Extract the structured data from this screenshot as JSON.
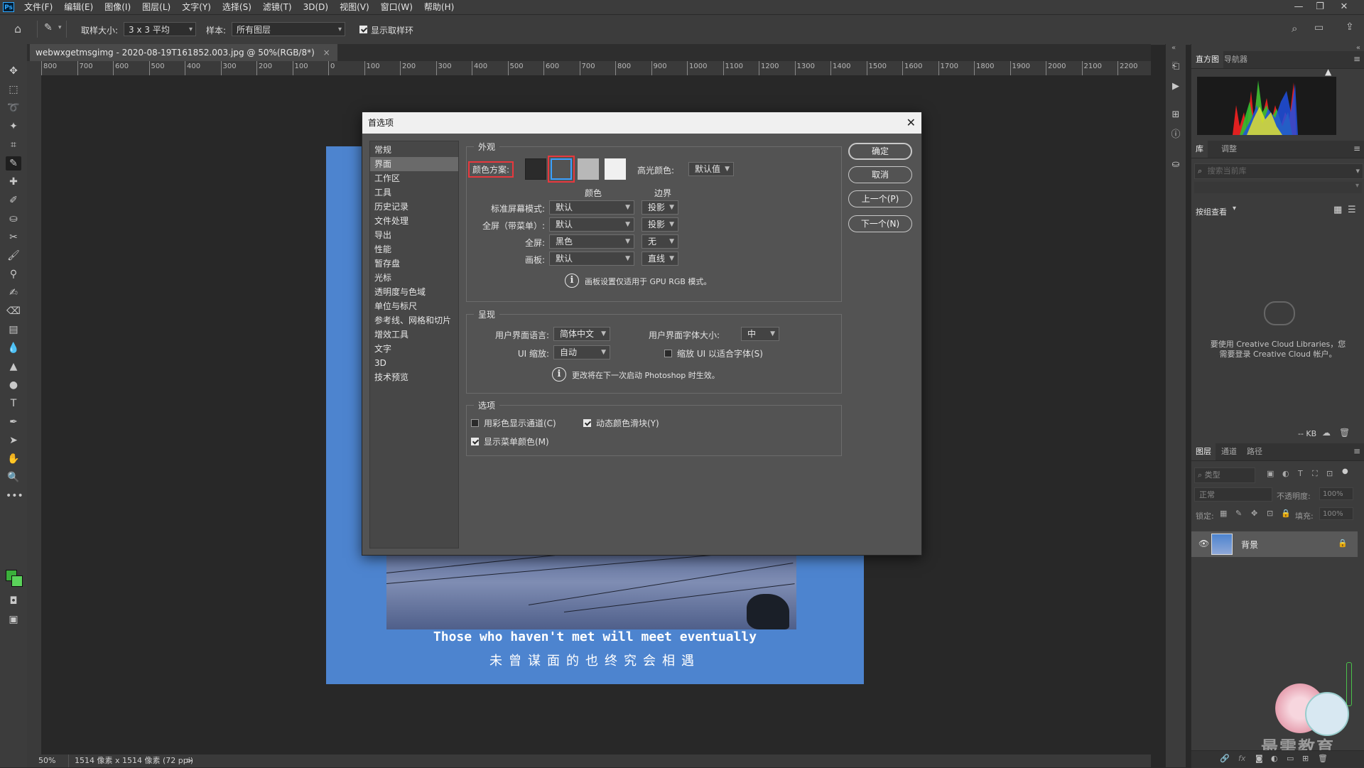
{
  "app": {
    "logo": "Ps",
    "menu": [
      "文件(F)",
      "编辑(E)",
      "图像(I)",
      "图层(L)",
      "文字(Y)",
      "选择(S)",
      "滤镜(T)",
      "3D(D)",
      "视图(V)",
      "窗口(W)",
      "帮助(H)"
    ]
  },
  "options_bar": {
    "sample_size_label": "取样大小:",
    "sample_size_value": "3 x 3 平均",
    "sample_label": "样本:",
    "sample_value": "所有图层",
    "show_ring_label": "显示取样环",
    "show_ring_checked": true
  },
  "document": {
    "tab_title": "webwxgetmsgimg - 2020-08-19T161852.003.jpg @ 50%(RGB/8*)",
    "tab_close": "×",
    "ruler_ticks": [
      "800",
      "700",
      "600",
      "500",
      "400",
      "300",
      "200",
      "100",
      "0",
      "100",
      "200",
      "300",
      "400",
      "500",
      "600",
      "700",
      "800",
      "900",
      "1000",
      "1100",
      "1200",
      "1300",
      "1400",
      "1500",
      "1600",
      "1700",
      "1800",
      "1900",
      "2000",
      "2100",
      "2200"
    ],
    "image_text_en": "Those who haven't met will meet eventually",
    "image_text_cn": "未曾谋面的也终究会相遇"
  },
  "status_bar": {
    "zoom": "50%",
    "info": "1514 像素 x 1514 像素 (72 ppi)",
    "arrow": ">"
  },
  "panels": {
    "histogram_tabs": [
      "直方图",
      "导航器"
    ],
    "library_tabs": [
      "库",
      "调整"
    ],
    "library_search_placeholder": "搜索当前库",
    "group_view_label": "按组查看",
    "cc_message_1": "要使用 Creative Cloud Libraries，您",
    "cc_message_2": "需要登录 Creative Cloud 帐户。",
    "kb_label": "-- KB",
    "layers_tabs": [
      "图层",
      "通道",
      "路径"
    ],
    "layers_filter_placeholder": "类型",
    "blend_mode": "正常",
    "opacity_label": "不透明度:",
    "opacity_value": "100%",
    "lock_label": "锁定:",
    "fill_label": "填充:",
    "fill_value": "100%",
    "layer_name": "背景",
    "watermark_text": "最需教育"
  },
  "dialog": {
    "title": "首选项",
    "close": "✕",
    "sidebar": [
      "常规",
      "界面",
      "工作区",
      "工具",
      "历史记录",
      "文件处理",
      "导出",
      "性能",
      "暂存盘",
      "光标",
      "透明度与色域",
      "单位与标尺",
      "参考线、网格和切片",
      "增效工具",
      "文字",
      "3D",
      "技术预览"
    ],
    "active_index": 1,
    "appearance": {
      "title": "外观",
      "color_scheme_label": "颜色方案:",
      "swatches": [
        "#2b2b2b",
        "#535353",
        "#b8b8b8",
        "#f0f0f0"
      ],
      "selected_swatch": 1,
      "highlight_label": "高光颜色:",
      "highlight_value": "默认值",
      "col_color": "颜色",
      "col_border": "边界",
      "rows": [
        {
          "label": "标准屏幕模式:",
          "color": "默认",
          "border": "投影"
        },
        {
          "label": "全屏（带菜单）:",
          "color": "默认",
          "border": "投影"
        },
        {
          "label": "全屏:",
          "color": "黑色",
          "border": "无"
        },
        {
          "label": "画板:",
          "color": "默认",
          "border": "直线"
        }
      ],
      "note": "画板设置仅适用于 GPU RGB 模式。"
    },
    "presentation": {
      "title": "呈现",
      "ui_language_label": "用户界面语言:",
      "ui_language_value": "简体中文",
      "ui_font_size_label": "用户界面字体大小:",
      "ui_font_size_value": "中",
      "ui_scale_label": "UI 缩放:",
      "ui_scale_value": "自动",
      "scale_to_font_label": "缩放 UI 以适合字体(S)",
      "scale_to_font_checked": false,
      "note": "更改将在下一次启动 Photoshop 时生效。"
    },
    "options": {
      "title": "选项",
      "color_channels_label": "用彩色显示通道(C)",
      "color_channels_checked": false,
      "dynamic_sliders_label": "动态颜色滑块(Y)",
      "dynamic_sliders_checked": true,
      "menu_colors_label": "显示菜单颜色(M)",
      "menu_colors_checked": true
    },
    "buttons": {
      "ok": "确定",
      "cancel": "取消",
      "prev": "上一个(P)",
      "next": "下一个(N)"
    }
  },
  "colors": {
    "accent_highlight": "#e8383d",
    "selected_swatch_border": "#3aa0ff",
    "image_bg": "#4d84cf",
    "fg_swatch": "#3bb03b",
    "bg_swatch": "#5ad25a"
  }
}
